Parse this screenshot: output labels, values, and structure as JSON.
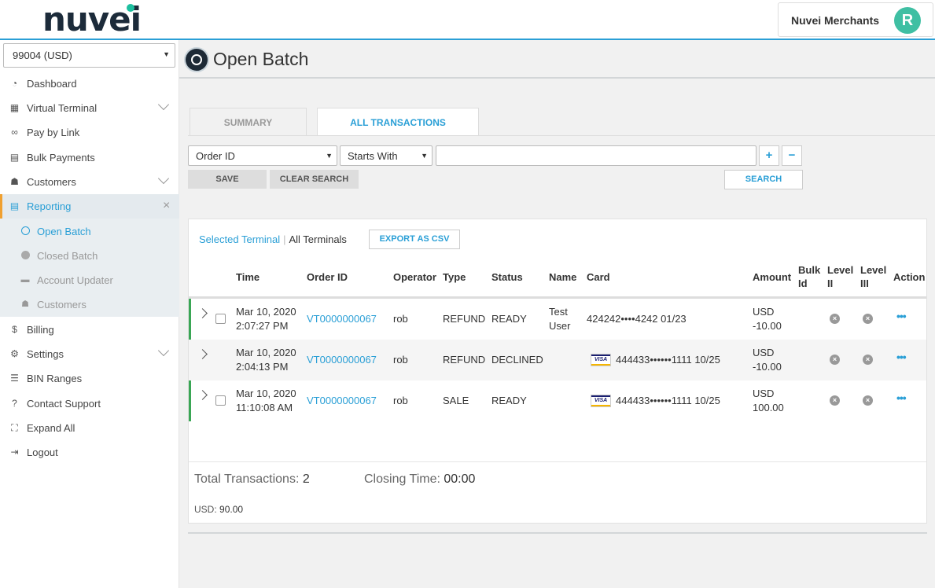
{
  "header": {
    "logo_text": "nuvei",
    "user_name": "Nuvei Merchants",
    "avatar_letter": "R"
  },
  "sidebar": {
    "terminal_value": "99004 (USD)",
    "items": [
      {
        "label": "Dashboard",
        "icon": "dashboard-icon"
      },
      {
        "label": "Virtual Terminal",
        "icon": "calculator-icon"
      },
      {
        "label": "Pay by Link",
        "icon": "link-icon"
      },
      {
        "label": "Bulk Payments",
        "icon": "file-icon"
      },
      {
        "label": "Customers",
        "icon": "users-icon"
      },
      {
        "label": "Reporting",
        "icon": "report-icon"
      },
      {
        "label": "Billing",
        "icon": "billing-icon"
      },
      {
        "label": "Settings",
        "icon": "gears-icon"
      },
      {
        "label": "BIN Ranges",
        "icon": "list-icon"
      },
      {
        "label": "Contact Support",
        "icon": "question-icon"
      },
      {
        "label": "Expand All",
        "icon": "expand-icon"
      },
      {
        "label": "Logout",
        "icon": "logout-icon"
      }
    ],
    "reporting_sub": [
      {
        "label": "Open Batch",
        "icon": "circle-outline-icon"
      },
      {
        "label": "Closed Batch",
        "icon": "circle-filled-icon"
      },
      {
        "label": "Account Updater",
        "icon": "card-icon"
      },
      {
        "label": "Customers",
        "icon": "users-icon"
      }
    ]
  },
  "page": {
    "title": "Open Batch"
  },
  "tabs": {
    "summary": "SUMMARY",
    "all_transactions": "ALL TRANSACTIONS"
  },
  "filters": {
    "field_value": "Order ID",
    "operator_value": "Starts With",
    "search_value": "",
    "plus": "+",
    "minus": "−",
    "save": "SAVE",
    "clear_search": "CLEAR SEARCH",
    "search": "SEARCH"
  },
  "panel": {
    "selected_terminal": "Selected Terminal",
    "separator": "|",
    "all_terminals": "All Terminals",
    "export_csv": "EXPORT AS CSV"
  },
  "table": {
    "headers": {
      "time": "Time",
      "order_id": "Order ID",
      "operator": "Operator",
      "type": "Type",
      "status": "Status",
      "name": "Name",
      "card": "Card",
      "amount": "Amount",
      "bulk_id_1": "Bulk",
      "bulk_id_2": "Id",
      "level2_1": "Level",
      "level2_2": "II",
      "level3_1": "Level",
      "level3_2": "III",
      "action": "Action"
    },
    "rows": [
      {
        "date": "Mar 10, 2020",
        "time": "2:07:27 PM",
        "order_id": "VT0000000067",
        "operator": "rob",
        "type": "REFUND",
        "status": "READY",
        "name_1": "Test",
        "name_2": "User",
        "card": "424242••••4242 01/23",
        "currency": "USD",
        "amount": "-10.00"
      },
      {
        "date": "Mar 10, 2020",
        "time": "2:04:13 PM",
        "order_id": "VT0000000067",
        "operator": "rob",
        "type": "REFUND",
        "status": "DECLINED",
        "name_1": "",
        "name_2": "",
        "card": "444433••••••1111 10/25",
        "currency": "USD",
        "amount": "-10.00"
      },
      {
        "date": "Mar 10, 2020",
        "time": "11:10:08 AM",
        "order_id": "VT0000000067",
        "operator": "rob",
        "type": "SALE",
        "status": "READY",
        "name_1": "",
        "name_2": "",
        "card": "444433••••••1111 10/25",
        "currency": "USD",
        "amount": "100.00"
      }
    ],
    "visa_label": "VISA",
    "action_glyph": "•••"
  },
  "summary": {
    "total_label": "Total Transactions:",
    "total_value": "2",
    "closing_label": "Closing Time:",
    "closing_value": "00:00",
    "usd_label": "USD:",
    "usd_value": "90.00"
  },
  "colors": {
    "accent": "#2a9fd6",
    "brand_dark": "#1c2b3a",
    "brand_green": "#1dbf9f",
    "active_border": "#f0a030",
    "row_marker": "#3aa655"
  }
}
